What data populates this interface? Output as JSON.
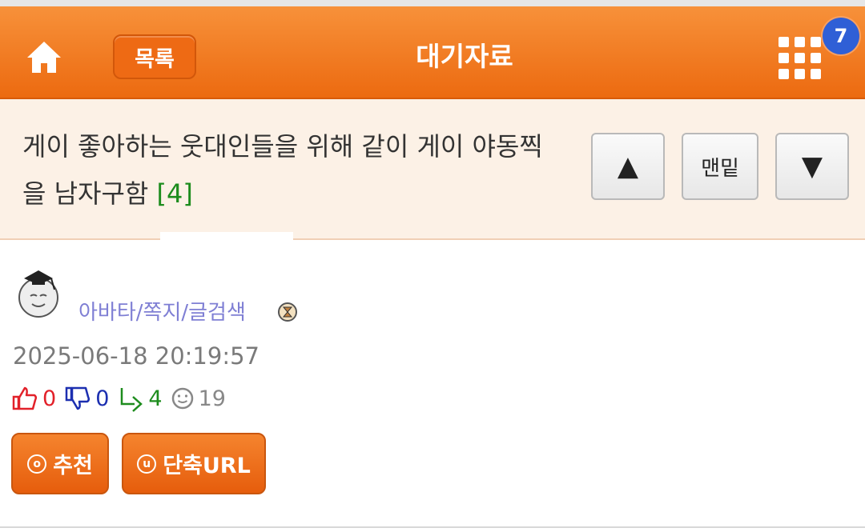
{
  "header": {
    "list_label": "목록",
    "title": "대기자료",
    "badge_count": "7",
    "brand_color": "#f07a1e"
  },
  "post": {
    "title": "게이 좋아하는 웃대인들을 위해 같이 게이 야동찍을 남자구함",
    "reply_count": "[4]",
    "nav": {
      "up": "▲",
      "bottom": "맨밑",
      "down": "▼"
    },
    "author_links": "아바타/쪽지/글검색",
    "date": "2025-06-18 20:19:57",
    "stats": {
      "likes": "0",
      "dislikes": "0",
      "replies": "4",
      "views": "19"
    },
    "recommend_label": "추천",
    "short_url_label": "단축URL",
    "recommend_icon": "o",
    "url_icon": "u"
  },
  "icons": [
    "home-icon",
    "grid-menu-icon",
    "thumbs-up-icon",
    "thumbs-down-icon",
    "reply-arrow-icon",
    "smiley-icon",
    "avatar-icon"
  ]
}
